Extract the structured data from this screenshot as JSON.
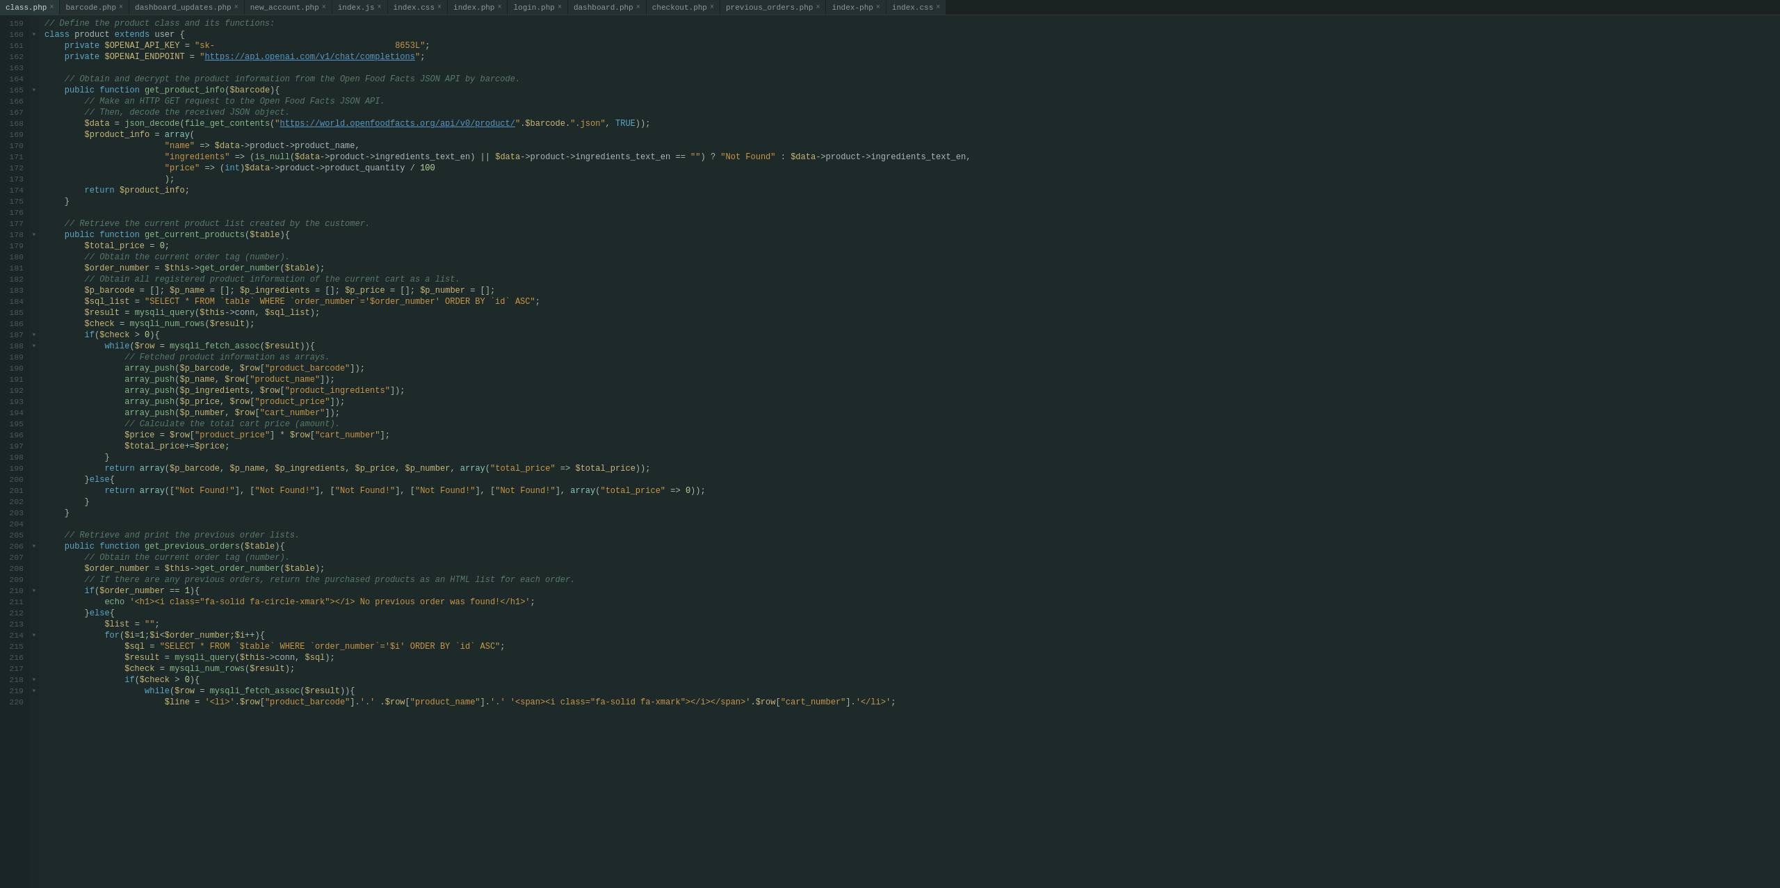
{
  "tabs": [
    {
      "label": "class.php",
      "active": true
    },
    {
      "label": "barcode.php",
      "active": false
    },
    {
      "label": "dashboard_updates.php",
      "active": false
    },
    {
      "label": "new_account.php",
      "active": false
    },
    {
      "label": "index.js",
      "active": false
    },
    {
      "label": "index.css",
      "active": false
    },
    {
      "label": "index.php",
      "active": false
    },
    {
      "label": "login.php",
      "active": false
    },
    {
      "label": "dashboard.php",
      "active": false
    },
    {
      "label": "checkout.php",
      "active": false
    },
    {
      "label": "previous_orders.php",
      "active": false
    },
    {
      "label": "index-php",
      "active": false
    },
    {
      "label": "index.css",
      "active": false
    }
  ],
  "line_start": 159,
  "line_end": 219
}
